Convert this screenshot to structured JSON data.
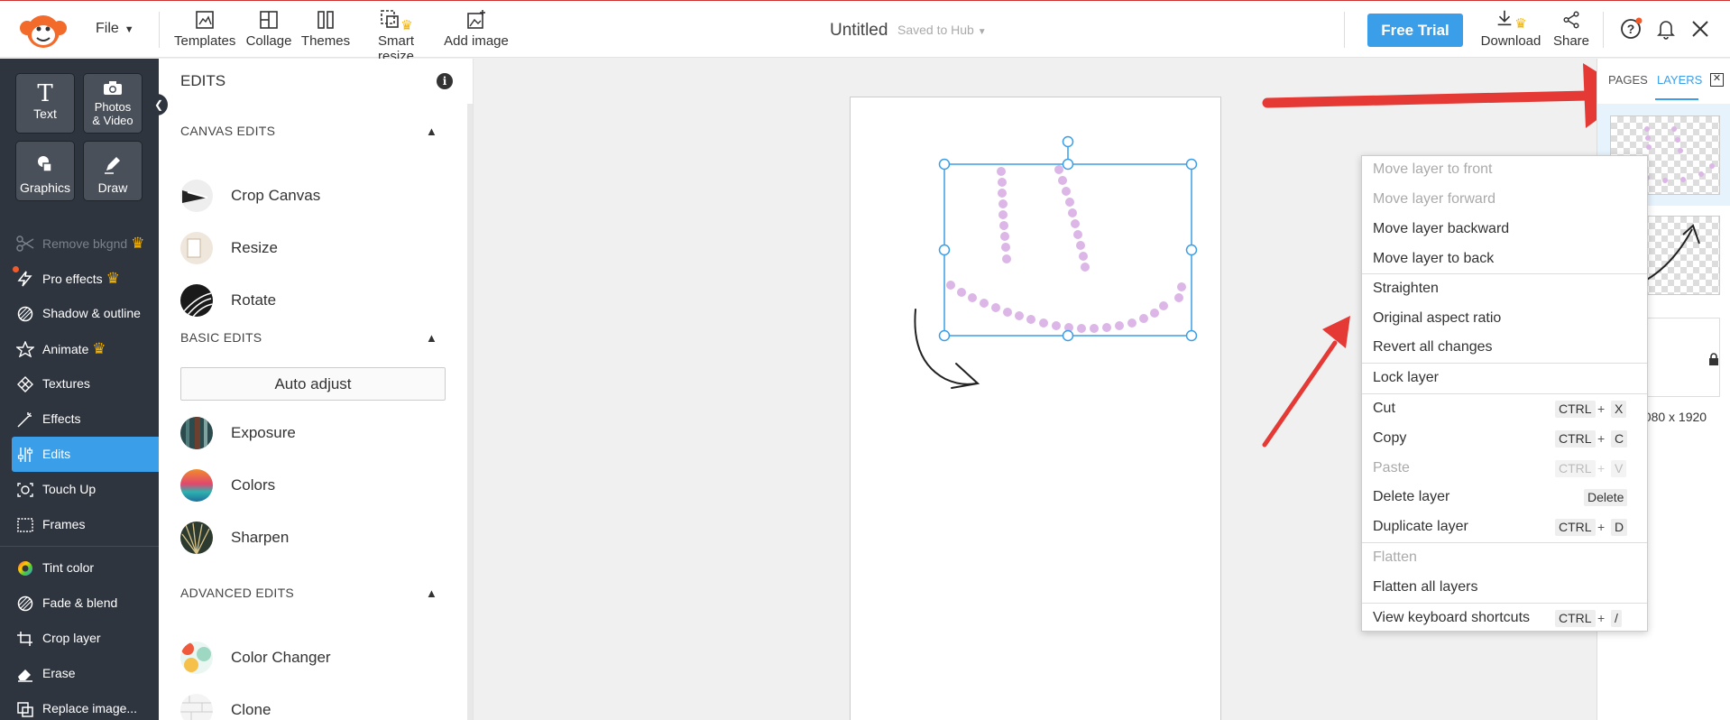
{
  "topbar": {
    "file_label": "File",
    "tools": [
      {
        "label": "Templates",
        "icon": "templates-icon"
      },
      {
        "label": "Collage",
        "icon": "collage-icon"
      },
      {
        "label": "Themes",
        "icon": "themes-icon"
      },
      {
        "label": "Smart resize",
        "icon": "smart-resize-icon"
      },
      {
        "label": "Add image",
        "icon": "add-image-icon"
      }
    ],
    "doc_title": "Untitled",
    "saved_status": "Saved to Hub",
    "free_trial_label": "Free Trial",
    "download_label": "Download",
    "share_label": "Share"
  },
  "leftnav": {
    "big_tools": [
      {
        "label": "Text",
        "icon": "text-icon"
      },
      {
        "label": "Photos & Video",
        "icon": "camera-icon"
      },
      {
        "label": "Graphics",
        "icon": "graphics-icon"
      },
      {
        "label": "Draw",
        "icon": "pen-icon"
      }
    ],
    "photos_line1": "Photos",
    "photos_line2": "& Video",
    "items": [
      {
        "label": "Remove bkgnd",
        "icon": "scissors-icon",
        "state": "disabled",
        "crown": true
      },
      {
        "label": "Pro effects",
        "icon": "bolt-icon",
        "crown": true
      },
      {
        "label": "Shadow & outline",
        "icon": "shadow-icon"
      },
      {
        "label": "Animate",
        "icon": "star-icon",
        "crown": true
      },
      {
        "label": "Textures",
        "icon": "texture-icon"
      },
      {
        "label": "Effects",
        "icon": "wand-icon"
      },
      {
        "label": "Edits",
        "icon": "sliders-icon",
        "state": "active"
      },
      {
        "label": "Touch Up",
        "icon": "face-icon"
      },
      {
        "label": "Frames",
        "icon": "frame-icon"
      },
      {
        "label": "Tint color",
        "icon": "color-wheel-icon"
      },
      {
        "label": "Fade & blend",
        "icon": "blend-icon"
      },
      {
        "label": "Crop layer",
        "icon": "crop-icon"
      },
      {
        "label": "Erase",
        "icon": "eraser-icon"
      },
      {
        "label": "Replace image...",
        "icon": "replace-icon"
      }
    ]
  },
  "edits_panel": {
    "title": "EDITS",
    "sections": {
      "canvas": "CANVAS EDITS",
      "basic": "BASIC EDITS",
      "advanced": "ADVANCED EDITS"
    },
    "canvas_items": [
      "Crop Canvas",
      "Resize",
      "Rotate"
    ],
    "auto_adjust": "Auto adjust",
    "basic_items": [
      "Exposure",
      "Colors",
      "Sharpen"
    ],
    "advanced_items": [
      "Color Changer",
      "Clone"
    ]
  },
  "right_panel": {
    "tab_pages": "PAGES",
    "tab_layers": "LAYERS",
    "canvas_size": "1080 x 1920"
  },
  "context_menu": {
    "items": [
      {
        "label": "Move layer to front",
        "disabled": true
      },
      {
        "label": "Move layer forward",
        "disabled": true
      },
      {
        "label": "Move layer backward"
      },
      {
        "label": "Move layer to back"
      },
      {
        "label": "Straighten"
      },
      {
        "label": "Original aspect ratio"
      },
      {
        "label": "Revert all changes"
      },
      {
        "label": "Lock layer"
      },
      {
        "label": "Cut",
        "mod": "CTRL",
        "key": "X"
      },
      {
        "label": "Copy",
        "mod": "CTRL",
        "key": "C"
      },
      {
        "label": "Paste",
        "mod": "CTRL",
        "key": "V",
        "disabled": true
      },
      {
        "label": "Delete layer",
        "key_single": "Delete"
      },
      {
        "label": "Duplicate layer",
        "mod": "CTRL",
        "key": "D"
      },
      {
        "label": "Flatten",
        "disabled": true
      },
      {
        "label": "Flatten all layers"
      },
      {
        "label": "View keyboard shortcuts",
        "mod": "CTRL",
        "key": "/"
      }
    ]
  },
  "colors": {
    "accent": "#3b9ee8",
    "nav_bg": "#2f353f",
    "arrow_red": "#e53935",
    "dots": "#dbb6e6"
  }
}
